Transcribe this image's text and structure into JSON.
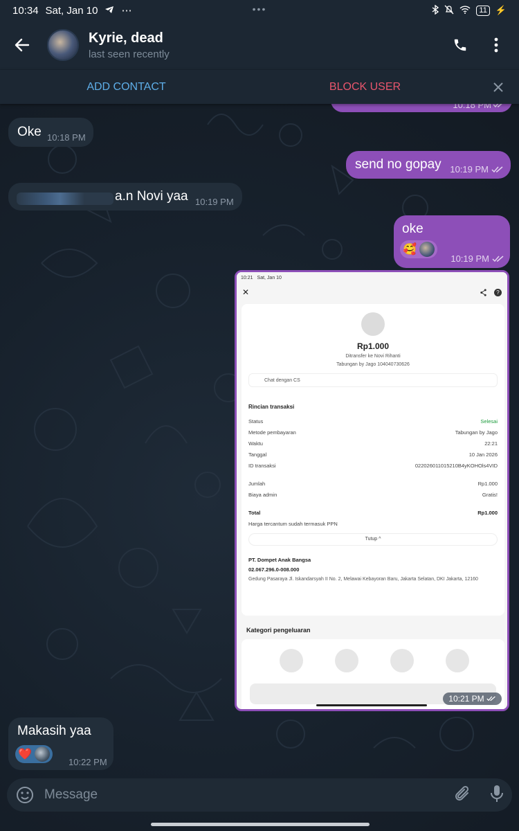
{
  "status_bar": {
    "time": "10:34",
    "date": "Sat, Jan 10",
    "battery": "11"
  },
  "header": {
    "contact_name": "Kyrie, dead",
    "last_seen": "last seen recently"
  },
  "action_bar": {
    "add_contact": "ADD CONTACT",
    "block_user": "BLOCK USER"
  },
  "messages": [
    {
      "direction": "out",
      "text": "",
      "time": "10:18 PM"
    },
    {
      "direction": "in",
      "text": "Oke",
      "time": "10:18 PM"
    },
    {
      "direction": "out",
      "text": "send no gopay",
      "time": "10:19 PM"
    },
    {
      "direction": "in",
      "text": "a.n Novi yaa",
      "time": "10:19 PM"
    },
    {
      "direction": "out",
      "text": "oke",
      "time": "10:19 PM",
      "reaction": "🥰"
    },
    {
      "direction": "out",
      "text": "",
      "time": "10:21 PM",
      "type": "image"
    },
    {
      "direction": "in",
      "text": "Makasih yaa",
      "time": "10:22 PM",
      "reaction": "❤️"
    }
  ],
  "photo": {
    "status_time": "10:21",
    "status_date": "Sat, Jan 10",
    "amount": "Rp1.000",
    "recipient": "Ditransfer ke Novi Rihanti",
    "account": "Tabungan by Jago 104040730626",
    "chat_cs": "Chat dengan CS",
    "details_title": "Rincian transaksi",
    "rows": [
      {
        "k": "Status",
        "v": "Selesai"
      },
      {
        "k": "Metode pembayaran",
        "v": "Tabungan by Jago"
      },
      {
        "k": "Waktu",
        "v": "22:21"
      },
      {
        "k": "Tanggal",
        "v": "10 Jan 2026"
      },
      {
        "k": "ID transaksi",
        "v": "022026011015210B4yKOHOls4VID"
      }
    ],
    "rows2": [
      {
        "k": "Jumlah",
        "v": "Rp1.000"
      },
      {
        "k": "Biaya admin",
        "v": "Gratis!"
      }
    ],
    "total_label": "Total",
    "total_value": "Rp1.000",
    "price_note": "Harga tercantum sudah termasuk PPN",
    "collapse": "Tutup",
    "company": "PT. Dompet Anak Bangsa",
    "npwp": "02.067.296.0-008.000",
    "address": "Gedung Pasaraya Jl. Iskandarsyah II No. 2, Melawai Kebayoran Baru, Jakarta Selatan, DKI Jakarta, 12160",
    "category_title": "Kategori pengeluaran"
  },
  "input": {
    "placeholder": "Message"
  },
  "colors": {
    "header_bg": "#1c2733",
    "incoming_bubble": "#222e3a",
    "outgoing_bubble": "#8d4fb8",
    "add_contact": "#5eaee8",
    "block_user": "#e8566d"
  }
}
